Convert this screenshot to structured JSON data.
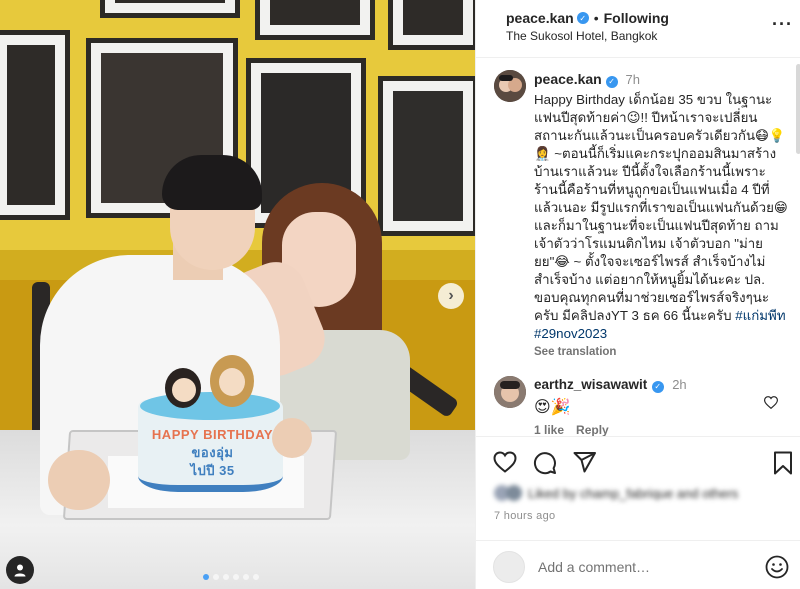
{
  "post": {
    "author": "peace.kan",
    "follow_status": "Following",
    "location": "The Sukosol Hotel, Bangkok",
    "time": "7h",
    "caption": "Happy Birthday เด็กน้อย 35 ขวบ ในฐานะแฟนปีสุดท้ายค่า😉!! ปีหน้าเราจะเปลี่ยนสถานะกันแล้วนะเป็นครอบครัวเดียวกัน😷💡\n👩‍⚕️ ~ตอนนี้ก็เริ่มแคะกระปุกออมสินมาสร้างบ้านเราแล้วนะ ปีนี้ตั้งใจเลือกร้านนี้เพราะร้านนี้คือร้านที่หนูถูกขอเป็นแฟนเมื่อ 4 ปีที่แล้วเนอะ มีรูปแรกที่เราขอเป็นแฟนกันด้วย😁 และก็มาในฐานะที่จะเป็นแฟนปีสุดท้าย ถามเจ้าตัวว่าโรแมนติกไหม เจ้าตัวบอก \"ม่ายยย\"😂 ~ ตั้งใจจะเซอร์ไพรส์ สำเร็จบ้างไม่สำเร็จบ้าง แต่อยากให้หนูยิ้มได้นะคะ ปล. ขอบคุณทุกคนที่มาช่วยเซอร์ไพรส์จริงๆนะครับ มีคลิปลงYT 3 ธค 66 นี้นะครับ ",
    "hashtags": "#แก่มพีท #29nov2023",
    "see_translation": "See translation"
  },
  "comment": {
    "user": "earthz_wisawawit",
    "time": "2h",
    "text": "😍🎉",
    "likes": "1 like",
    "reply": "Reply"
  },
  "footer": {
    "liked_by": "Liked by champ_fabrique and others",
    "ago": "7 hours ago",
    "add_comment_placeholder": "Add a comment…"
  },
  "photo": {
    "cake_line1": "HAPPY BIRTHDAY",
    "cake_line2": "ของอุ่ม",
    "cake_line3": "ไปปี 35",
    "carousel_total": 6,
    "carousel_active": 1
  },
  "icons": {
    "verified": "verified-badge-icon",
    "more": "more-options-icon",
    "heart": "heart-icon",
    "comment": "comment-icon",
    "share": "share-icon",
    "save": "bookmark-icon",
    "emoji": "emoji-icon",
    "next": "chevron-right-icon",
    "user_tag": "user-tag-icon"
  },
  "colors": {
    "verified": "#3897f0",
    "link": "#00376b",
    "muted": "#8e8e8e"
  }
}
